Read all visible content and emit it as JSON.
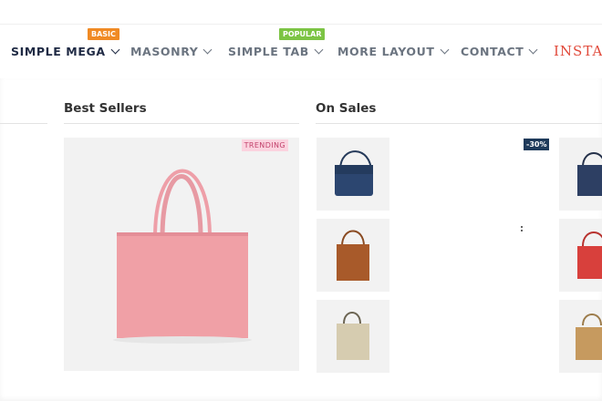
{
  "nav": {
    "items": [
      {
        "label": "SIMPLE MEGA"
      },
      {
        "label": "MASONRY"
      },
      {
        "label": "SIMPLE TAB"
      },
      {
        "label": "MORE LAYOUT"
      },
      {
        "label": "CONTACT"
      },
      {
        "label": "INSTAL"
      }
    ],
    "badges": {
      "basic": "BASIC",
      "popular": "POPULAR"
    }
  },
  "mega": {
    "best_sellers_title": "Best Sellers",
    "on_sales_title": "On Sales",
    "trending_label": "TRENDING",
    "sale_label": "-30%"
  },
  "colors": {
    "accent_install": "#e14a3b",
    "badge_basic": "#f08a24",
    "badge_popular": "#7cc444",
    "sale_badge": "#1e3a5a",
    "trending_bg": "#fbd3df"
  }
}
